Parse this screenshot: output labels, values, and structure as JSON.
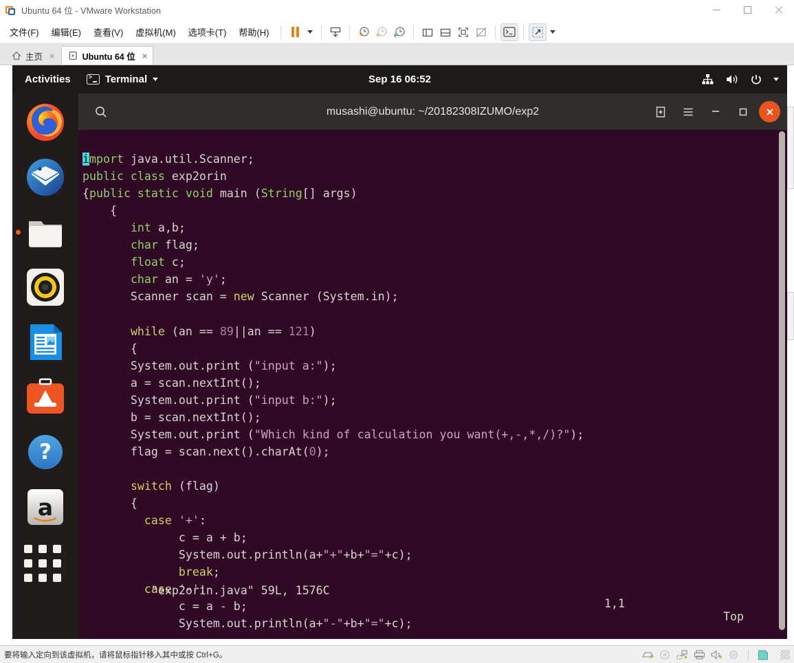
{
  "vmware": {
    "title": "Ubuntu 64 位 - VMware Workstation",
    "app_icon": "vmware-icon",
    "window_controls": {
      "minimize": "minimize-icon",
      "maximize": "maximize-icon",
      "close": "close-icon"
    },
    "menu": [
      {
        "label": "文件(F)",
        "name": "menu-file"
      },
      {
        "label": "编辑(E)",
        "name": "menu-edit"
      },
      {
        "label": "查看(V)",
        "name": "menu-view"
      },
      {
        "label": "虚拟机(M)",
        "name": "menu-vm"
      },
      {
        "label": "选项卡(T)",
        "name": "menu-tabs"
      },
      {
        "label": "帮助(H)",
        "name": "menu-help"
      }
    ],
    "toolbar": [
      {
        "name": "suspend-button",
        "icon": "pause-icon"
      },
      {
        "name": "power-dropdown",
        "icon": "chevron-down-icon"
      },
      {
        "name": "snapshot-button",
        "icon": "snapshot-icon"
      },
      {
        "name": "take-snapshot-button",
        "icon": "clock-plus-icon"
      },
      {
        "name": "revert-snapshot-button",
        "icon": "clock-back-icon"
      },
      {
        "name": "manage-snapshots-button",
        "icon": "clock-settings-icon"
      },
      {
        "name": "show-library-button",
        "icon": "panel-left-icon"
      },
      {
        "name": "show-thumbnail-bar-button",
        "icon": "panel-bottom-icon"
      },
      {
        "name": "fullscreen-button",
        "icon": "fullscreen-icon"
      },
      {
        "name": "unity-mode-button",
        "icon": "unity-off-icon"
      },
      {
        "name": "console-view-button",
        "icon": "terminal-icon"
      },
      {
        "name": "send-key-button",
        "icon": "send-key-icon"
      },
      {
        "name": "send-key-dropdown",
        "icon": "chevron-down-icon"
      }
    ],
    "tabs": [
      {
        "label": "主页",
        "icon": "home-icon",
        "active": false,
        "close": "×"
      },
      {
        "label": "Ubuntu 64 位",
        "icon": "vm-play-icon",
        "active": true,
        "close": "×"
      }
    ],
    "statusbar": {
      "hint": "要将输入定向到该虚拟机，请将鼠标指针移入其中或按 Ctrl+G。",
      "devices": [
        "harddisk-icon",
        "cdrom-icon",
        "network-icon",
        "printer-icon",
        "sound-icon",
        "usb-icon",
        "display-icon"
      ]
    }
  },
  "guest": {
    "topbar": {
      "activities": "Activities",
      "app_menu": "Terminal",
      "app_menu_icon": "terminal-icon",
      "app_menu_caret": "chevron-down-icon",
      "clock": "Sep 16  06:52",
      "status_icons": [
        "network-wired-icon",
        "volume-icon",
        "power-icon",
        "chevron-down-icon"
      ]
    },
    "dock": [
      {
        "name": "dock-item-firefox",
        "label": "Firefox",
        "running": false
      },
      {
        "name": "dock-item-thunderbird",
        "label": "Thunderbird Mail",
        "running": false
      },
      {
        "name": "dock-item-files",
        "label": "Files",
        "running": true
      },
      {
        "name": "dock-item-rhythmbox",
        "label": "Rhythmbox",
        "running": false
      },
      {
        "name": "dock-item-writer",
        "label": "LibreOffice Writer",
        "running": false
      },
      {
        "name": "dock-item-software",
        "label": "Ubuntu Software",
        "running": false
      },
      {
        "name": "dock-item-help",
        "label": "Help",
        "running": false
      },
      {
        "name": "dock-item-amazon",
        "label": "Amazon",
        "running": false
      },
      {
        "name": "dock-item-show-apps",
        "label": "Show Applications",
        "running": false
      }
    ],
    "terminal": {
      "title": "musashi@ubuntu: ~/20182308IZUMO/exp2",
      "header_buttons": {
        "search": "search-icon",
        "new_tab": "new-tab-icon",
        "menu": "hamburger-icon",
        "minimize": "minimize-icon",
        "maximize": "maximize-icon",
        "close": "close-icon"
      },
      "editor": "vim",
      "code_lines": [
        "import java.util.Scanner;",
        "public class exp2orin",
        "{public static void main (String[] args)",
        "    {",
        "       int a,b;",
        "       char flag;",
        "       float c;",
        "       char an = 'y';",
        "       Scanner scan = new Scanner (System.in);",
        "",
        "       while (an == 89||an == 121)",
        "       {",
        "       System.out.print (\"input a:\");",
        "       a = scan.nextInt();",
        "       System.out.print (\"input b:\");",
        "       b = scan.nextInt();",
        "       System.out.print (\"Which kind of calculation you want(+,-,*,/)?\");",
        "       flag = scan.next().charAt(0);",
        "",
        "       switch (flag)",
        "       {",
        "         case '+':",
        "              c = a + b;",
        "              System.out.println(a+\"+\"+b+\"=\"+c);",
        "              break;",
        "         case '-':",
        "              c = a - b;",
        "              System.out.println(a+\"-\"+b+\"=\"+c);"
      ],
      "status": {
        "file": "\"exp2orin.java\" 59L, 1576C",
        "cursor": "1,1",
        "position": "Top"
      }
    }
  },
  "colors": {
    "terminal_bg": "#300a24",
    "ubuntu_orange": "#e95420",
    "vmware_orange": "#e8820c",
    "gnome_dark": "#1b1a19",
    "header_gray": "#302d2c"
  }
}
